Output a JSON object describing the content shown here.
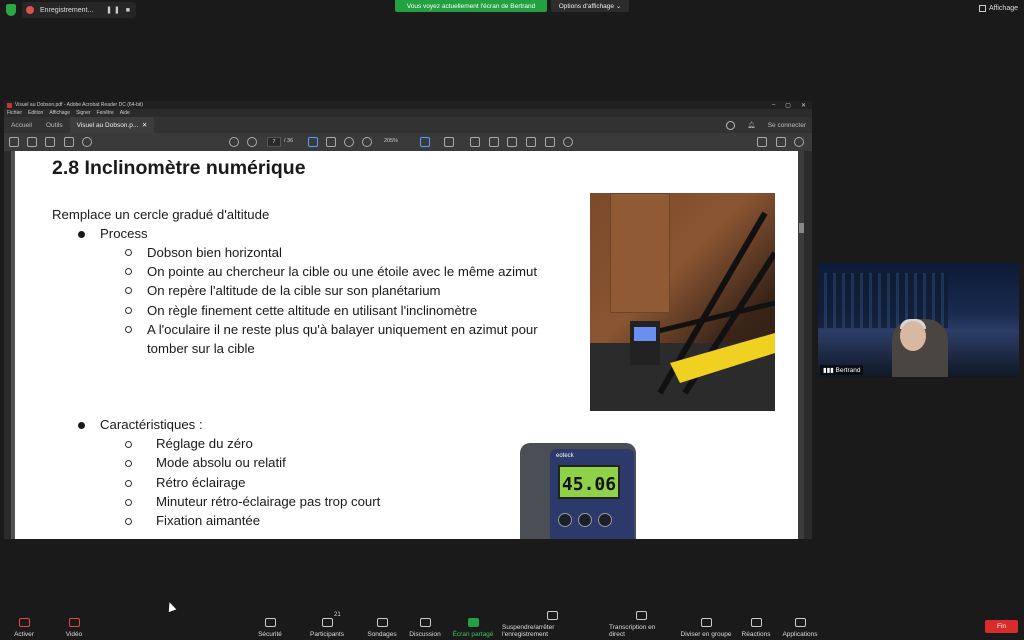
{
  "zoom_top": {
    "recording_label": "Enregistrement...",
    "share_banner": "Vous voyez actuellement l'écran de Bertrand",
    "view_options": "Options d'affichage",
    "view_button": "Affichage"
  },
  "acrobat": {
    "window_title": "Visuel au Dobson.pdf - Adobe Acrobat Reader DC (64-bit)",
    "menu": [
      "Fichier",
      "Edition",
      "Affichage",
      "Signer",
      "Fenêtre",
      "Aide"
    ],
    "tabs": [
      "Accueil",
      "Outils",
      "Visuel au Dobson.p..."
    ],
    "signin": "Se connecter",
    "page_current": "7",
    "page_total": "/ 36",
    "zoom": "205%"
  },
  "slide": {
    "title": "2.8 Inclinomètre numérique",
    "intro": "Remplace un cercle gradué d'altitude",
    "section1": "Process",
    "process_items": [
      "Dobson bien horizontal",
      "On pointe au chercheur la cible ou une étoile avec le même azimut",
      "On repère l'altitude de la cible sur son planétarium",
      "On règle finement cette altitude en utilisant l'inclinomètre",
      "A l'oculaire il ne reste plus qu'à balayer uniquement en azimut pour",
      "tomber sur la cible"
    ],
    "section2": "Caractéristiques :",
    "char_items": [
      "Réglage du zéro",
      "Mode absolu ou relatif",
      "Rétro éclairage",
      "Minuteur rétro-éclairage pas trop court",
      "Fixation aimantée"
    ],
    "device_brand": "eoteck",
    "device_reading": "45.06"
  },
  "participant": {
    "name": "Bertrand"
  },
  "zoom_bar": {
    "activer": "Activer",
    "video": "Vidéo",
    "securite": "Sécurité",
    "participants": "Participants",
    "participants_count": "21",
    "sondages": "Sondages",
    "discussion": "Discussion",
    "ecran_partage": "Écran partagé",
    "suspendre": "Suspendre/arrêter l'enregistrement",
    "transcription": "Transcription en direct",
    "diviser": "Diviser en groupe",
    "reactions": "Réactions",
    "applications": "Applications",
    "fin": "Fin"
  }
}
